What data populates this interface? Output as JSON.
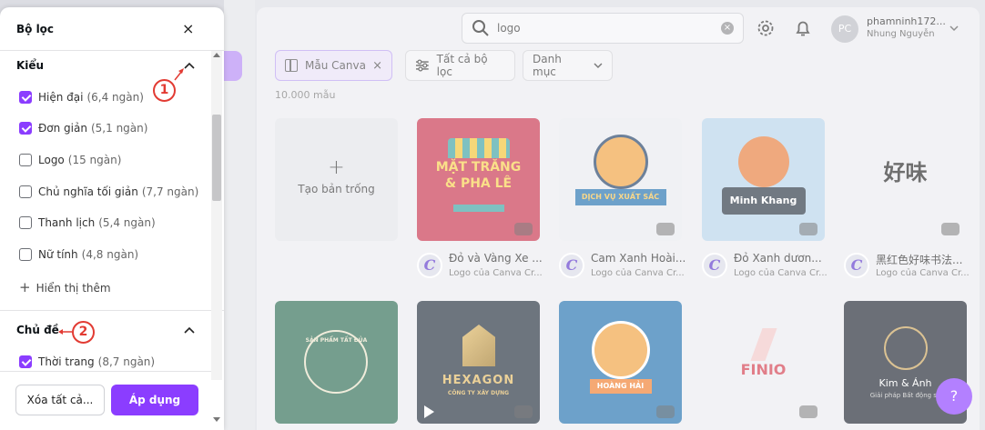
{
  "filter_panel": {
    "title": "Bộ lọc",
    "close": "×",
    "section_style": {
      "title": "Kiểu",
      "options": [
        {
          "label": "Hiện đại",
          "count": "(6,4 ngàn)",
          "checked": true
        },
        {
          "label": "Đơn giản",
          "count": "(5,1 ngàn)",
          "checked": true
        },
        {
          "label": "Logo",
          "count": "(15 ngàn)",
          "checked": false
        },
        {
          "label": "Chủ nghĩa tối giản",
          "count": "(7,7 ngàn)",
          "checked": false
        },
        {
          "label": "Thanh lịch",
          "count": "(5,4 ngàn)",
          "checked": false
        },
        {
          "label": "Nữ tính",
          "count": "(4,8 ngàn)",
          "checked": false
        }
      ],
      "show_more": "Hiển thị thêm"
    },
    "section_topic": {
      "title": "Chủ đề",
      "options": [
        {
          "label": "Thời trang",
          "count": "(8,7 ngàn)",
          "checked": true
        }
      ]
    },
    "clear_all": "Xóa tất cả...",
    "apply": "Áp dụng"
  },
  "annotations": {
    "one": "1",
    "two": "2"
  },
  "search": {
    "value": "logo",
    "clear": "×"
  },
  "user": {
    "initials": "PC",
    "name": "phamninh172...",
    "subtitle": "Nhung Nguyễn"
  },
  "chips": {
    "canva": "Mẫu Canva",
    "canva_close": "×",
    "all_filters": "Tất cả bộ lọc",
    "category": "Danh mục"
  },
  "result_count": "10.000 mẫu",
  "blank": {
    "plus": "+",
    "label": "Tạo bản trống"
  },
  "cards_row1": [
    {
      "title": "Đỏ và Vàng Xe ...",
      "subtitle": "Logo của Canva Cr...",
      "art": [
        "MẶT TRĂNG",
        "& PHA LÊ"
      ]
    },
    {
      "title": "Cam Xanh Hoài...",
      "subtitle": "Logo của Canva Cr...",
      "art": [
        "DỊCH VỤ XUẤT SẮC"
      ]
    },
    {
      "title": "Đỏ Xanh dươn...",
      "subtitle": "Logo của Canva Cr...",
      "art": [
        "Minh Khang"
      ]
    },
    {
      "title": "黑红色好味书法...",
      "subtitle": "Logo của Canva Cr...",
      "art": [
        "好味"
      ]
    }
  ],
  "cards_row2": [
    {
      "art": [
        "SẢN PHẨM TẤT ĐỦA"
      ]
    },
    {
      "art": [
        "HEXAGON",
        "CÔNG TY XÂY DỰNG"
      ]
    },
    {
      "art": [
        "HOÀNG HẢI"
      ]
    },
    {
      "art": [
        "FINIO"
      ]
    },
    {
      "art": [
        "Kim & Ánh",
        "Giải pháp Bất động sả"
      ]
    }
  ],
  "meta_logo_letter": "C",
  "help": "?"
}
